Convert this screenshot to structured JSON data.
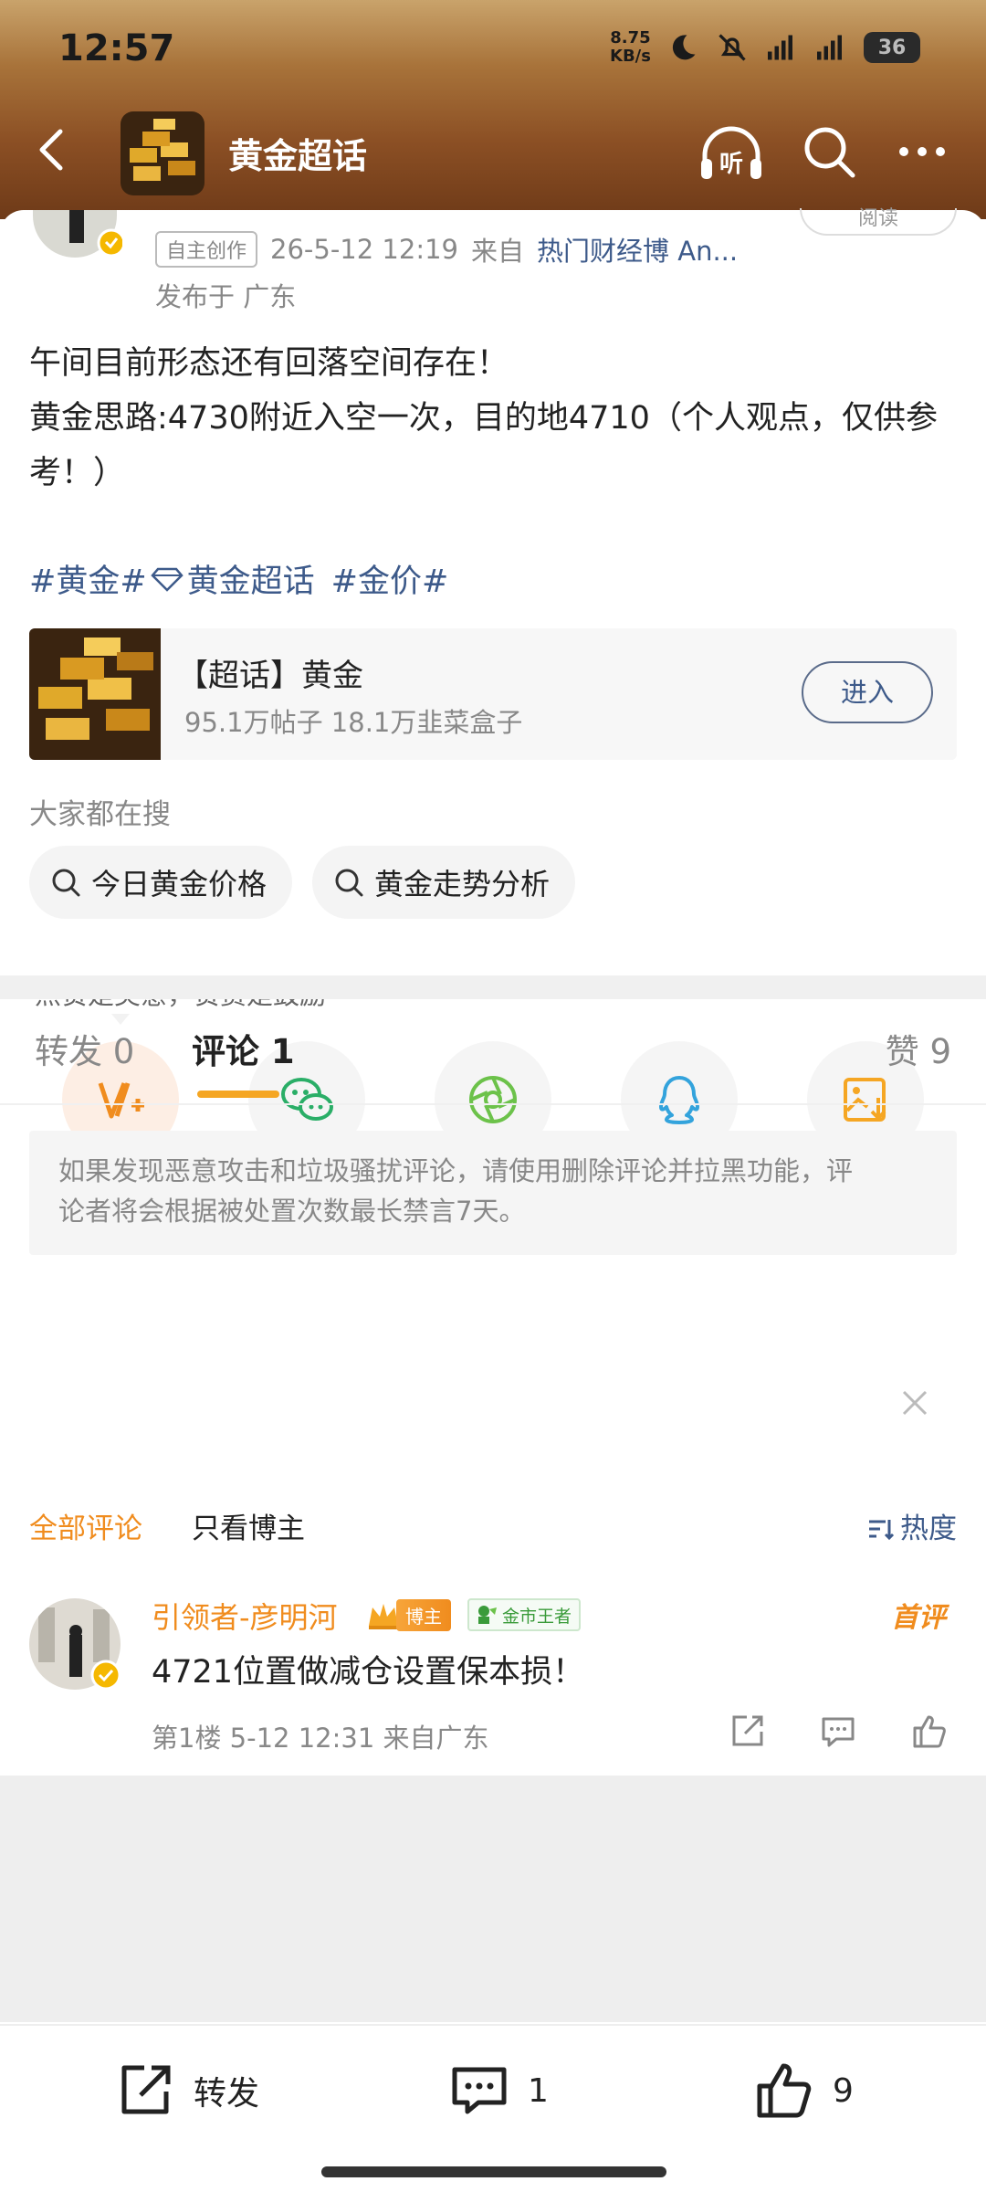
{
  "status": {
    "time": "12:57",
    "net_speed_value": "8.75",
    "net_speed_unit": "KB/s",
    "battery": "36"
  },
  "nav": {
    "title": "黄金超话",
    "listen_label": "听"
  },
  "post": {
    "read_label": "阅读",
    "self_created_badge": "自主创作",
    "timestamp": "26-5-12 12:19",
    "from_prefix": "来自",
    "source": "热门财经博 An...",
    "location": "发布于 广东",
    "text_line1": "午间目前形态还有回落空间存在！",
    "text_line2": "黄金思路:4730附近入空一次，目的地4710（个人观点，仅供参考！）",
    "tag1": "#黄金#",
    "tag2": "黄金超话",
    "tag3": "#金价#"
  },
  "topic_card": {
    "title": "【超话】黄金",
    "stats": "95.1万帖子 18.1万韭菜盒子",
    "enter_label": "进入"
  },
  "search": {
    "title": "大家都在搜",
    "chips": [
      "今日黄金价格",
      "黄金走势分析"
    ]
  },
  "reward": {
    "tip": "点赞是美意，赞赏是鼓励"
  },
  "share_icons": [
    "reward-icon",
    "wechat-icon",
    "moments-icon",
    "qq-icon",
    "save-image-icon"
  ],
  "tabs": {
    "repost_label": "转发",
    "repost_count": "0",
    "comment_label": "评论",
    "comment_count": "1",
    "like_label": "赞",
    "like_count": "9"
  },
  "notice": {
    "text": "如果发现恶意攻击和垃圾骚扰评论，请使用删除评论并拉黑功能，评论者将会根据被处置次数最长禁言7天。"
  },
  "filters": {
    "all_label": "全部评论",
    "owner_only_label": "只看博主",
    "sort_label": "热度"
  },
  "comment": {
    "author": "引领者-彦明河",
    "owner_badge": "博主",
    "gold_badge": "金市王者",
    "first_badge": "首评",
    "text": "4721位置做减仓设置保本损！",
    "meta": "第1楼 5-12 12:31 来自广东"
  },
  "bottombar": {
    "repost_label": "转发",
    "comment_count": "1",
    "like_count": "9"
  },
  "colors": {
    "accent_orange": "#f08c1e",
    "link_blue": "#3d5a8a",
    "tab_underline": "#f5a623"
  }
}
